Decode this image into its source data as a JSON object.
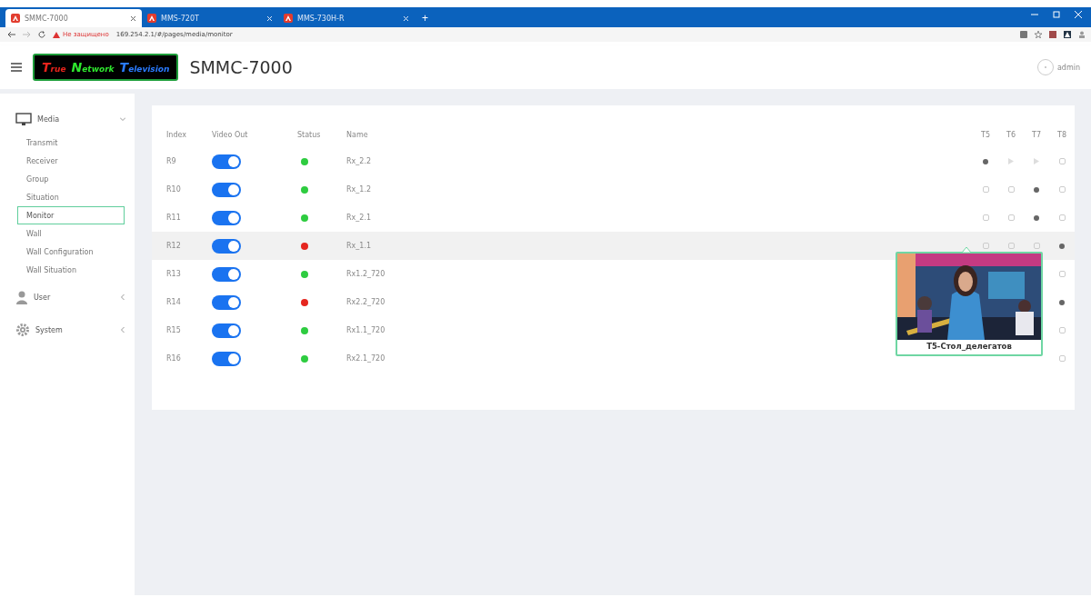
{
  "browser": {
    "tabs": [
      {
        "title": "SMMC-7000",
        "selected": true
      },
      {
        "title": "MMS-720T",
        "selected": false
      },
      {
        "title": "MMS-730H-R",
        "selected": false
      }
    ],
    "new_tab": "+",
    "security_warning": "Не защищено",
    "url": "169.254.2.1/#/pages/media/monitor"
  },
  "header": {
    "logo_words": [
      {
        "text": "True",
        "color": "#e8241c"
      },
      {
        "text": "Network",
        "color": "#2ee82e"
      },
      {
        "text": "Television",
        "color": "#2a7bff"
      }
    ],
    "title": "SMMC-7000",
    "user": "admin"
  },
  "sidebar": {
    "sections": [
      {
        "label": "Media",
        "expanded": true,
        "kind": "monitor",
        "items": [
          {
            "label": "Transmit",
            "selected": false
          },
          {
            "label": "Receiver",
            "selected": false
          },
          {
            "label": "Group",
            "selected": false
          },
          {
            "label": "Situation",
            "selected": false
          },
          {
            "label": "Monitor",
            "selected": true
          },
          {
            "label": "Wall",
            "selected": false
          },
          {
            "label": "Wall Configuration",
            "selected": false
          },
          {
            "label": "Wall Situation",
            "selected": false
          }
        ]
      },
      {
        "label": "User",
        "expanded": false,
        "kind": "user"
      },
      {
        "label": "System",
        "expanded": false,
        "kind": "gear"
      }
    ]
  },
  "table": {
    "columns": [
      "Index",
      "Video Out",
      "Status",
      "Name",
      "T5",
      "T6",
      "T7",
      "T8"
    ],
    "rows": [
      {
        "index": "R9",
        "video_out": true,
        "color": "#2ecc40",
        "name": "Rx_2.2",
        "outputs": [
          {
            "kind": "select",
            "selected": true
          },
          {
            "kind": "play"
          },
          {
            "kind": "play"
          },
          {
            "kind": "select",
            "selected": false
          }
        ]
      },
      {
        "index": "R10",
        "video_out": true,
        "color": "#2ecc40",
        "name": "Rx_1.2",
        "outputs": [
          {
            "kind": "select",
            "selected": false
          },
          {
            "kind": "select",
            "selected": false
          },
          {
            "kind": "select",
            "selected": true
          },
          {
            "kind": "select",
            "selected": false
          }
        ]
      },
      {
        "index": "R11",
        "video_out": true,
        "color": "#2ecc40",
        "name": "Rx_2.1",
        "outputs": [
          {
            "kind": "select",
            "selected": false
          },
          {
            "kind": "select",
            "selected": false
          },
          {
            "kind": "select",
            "selected": true
          },
          {
            "kind": "select",
            "selected": false
          }
        ]
      },
      {
        "index": "R12",
        "video_out": true,
        "color": "#e5261f",
        "name": "Rx_1.1",
        "outputs": [
          {
            "kind": "select",
            "selected": false
          },
          {
            "kind": "select",
            "selected": false
          },
          {
            "kind": "select",
            "selected": false
          },
          {
            "kind": "select",
            "selected": true
          }
        ]
      },
      {
        "index": "R13",
        "video_out": true,
        "color": "#2ecc40",
        "name": "Rx1.2_720",
        "outputs": [
          {
            "kind": "select",
            "selected": false
          }
        ]
      },
      {
        "index": "R14",
        "video_out": true,
        "color": "#e5261f",
        "name": "Rx2.2_720",
        "outputs": [
          {
            "kind": "select",
            "selected": true
          }
        ]
      },
      {
        "index": "R15",
        "video_out": true,
        "color": "#2ecc40",
        "name": "Rx1.1_720",
        "outputs": [
          {
            "kind": "select",
            "selected": false
          }
        ]
      },
      {
        "index": "R16",
        "video_out": true,
        "color": "#2ecc40",
        "name": "Rx2.1_720",
        "outputs": [
          {
            "kind": "select",
            "selected": false
          }
        ]
      }
    ]
  },
  "preview": {
    "kind": "picture",
    "caption": "T5-Стол_делегатов"
  }
}
